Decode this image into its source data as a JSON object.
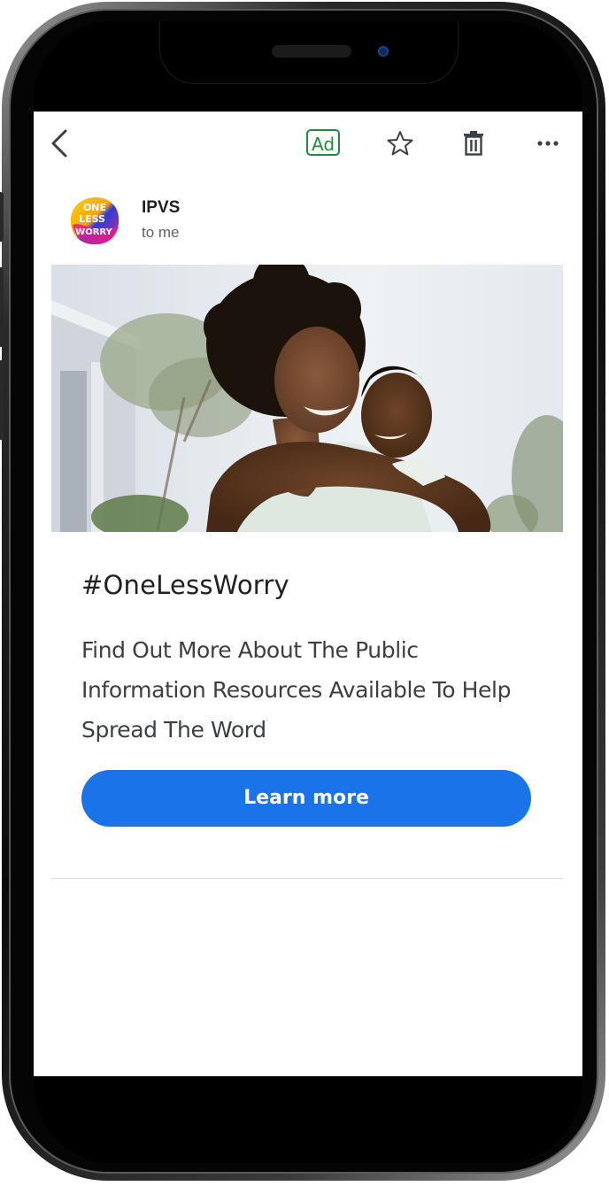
{
  "toolbar": {
    "back_icon": "chevron-left-icon",
    "ad_label": "Ad",
    "star_icon": "star-outline-icon",
    "delete_icon": "trash-icon",
    "more_icon": "more-horizontal-icon"
  },
  "sender": {
    "name": "IPVS",
    "recipient": "to me",
    "logo_text": [
      "ONE",
      "LESS",
      "WORRY"
    ]
  },
  "ad": {
    "image": "photo of smiling woman carrying child on her back outdoors",
    "headline": "#OneLessWorry",
    "body": "Find Out More About The Public Information Resources Available To Help Spread The Word",
    "cta_label": "Learn more"
  },
  "colors": {
    "accent": "#1a73e8",
    "ad_badge": "#1e8e3e",
    "text_primary": "#202124",
    "text_secondary": "#5f6368",
    "divider": "#dadce0"
  }
}
